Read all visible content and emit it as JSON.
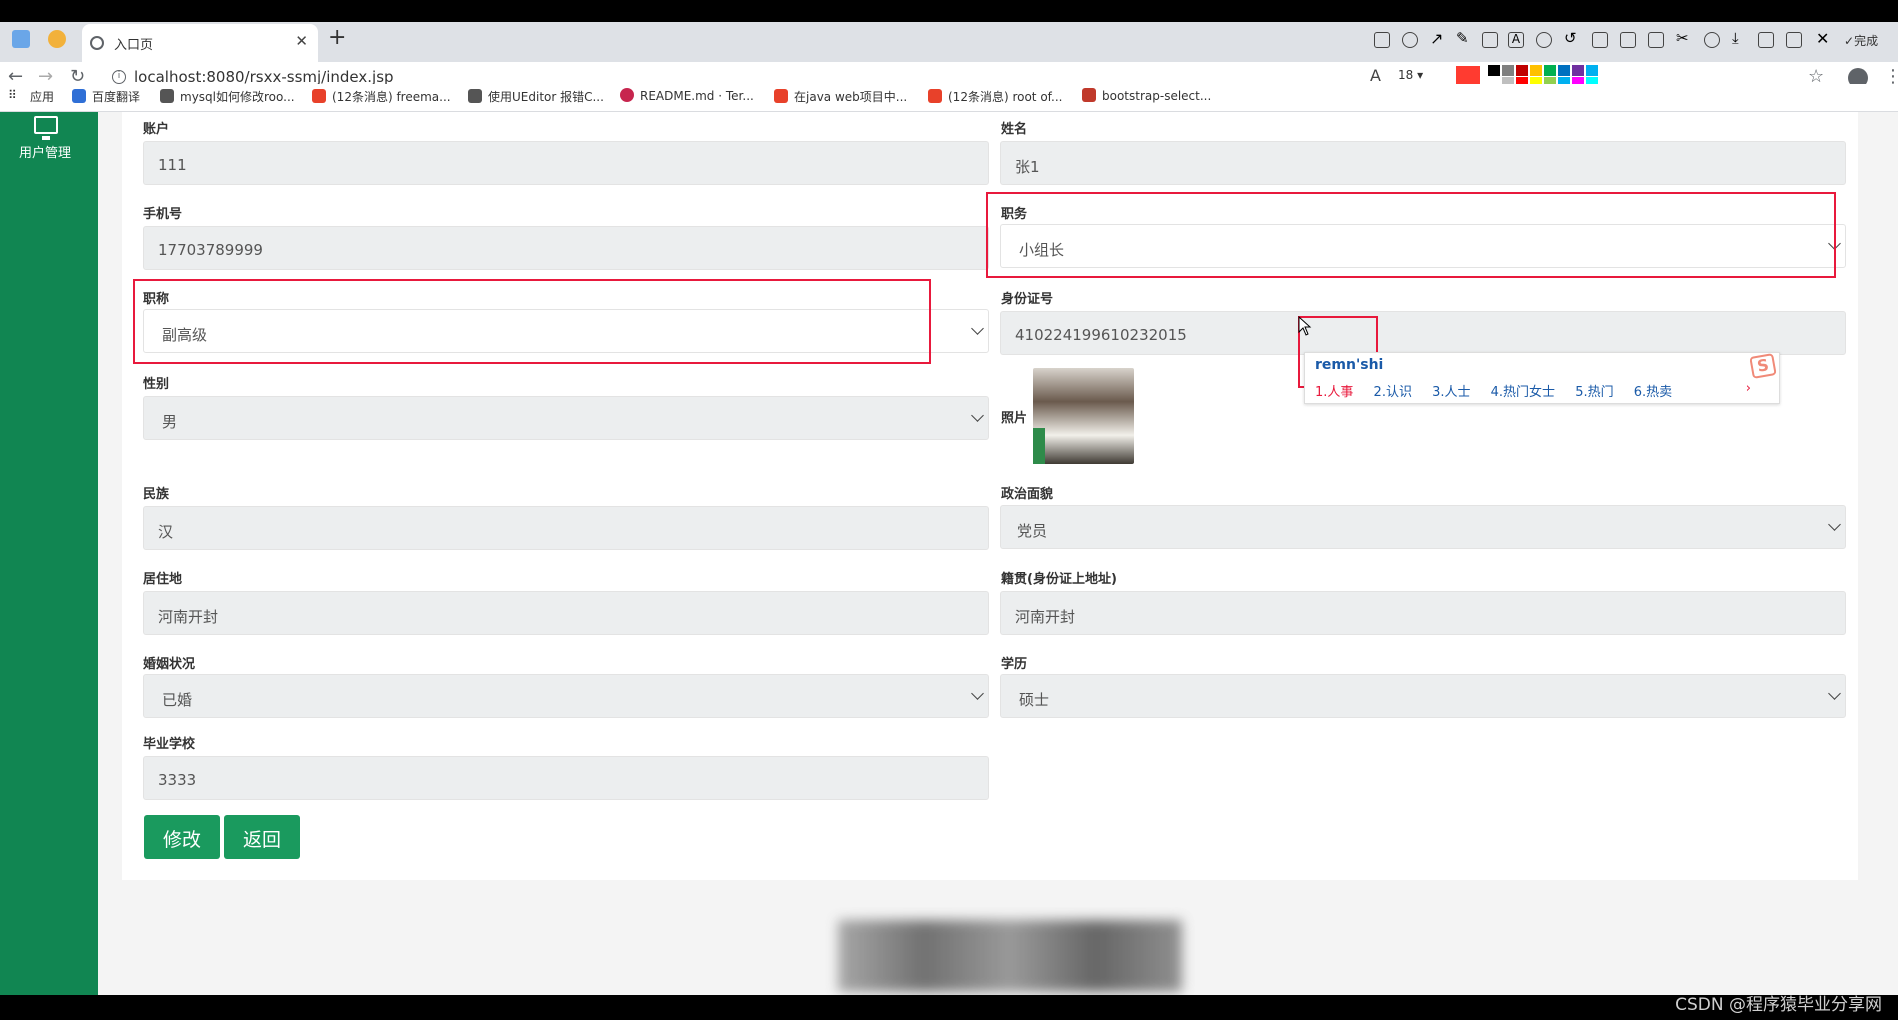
{
  "browser": {
    "tab_title": "入口页",
    "new_tab": "+",
    "url": "localhost:8080/rsxx-ssmj/index.jsp",
    "bookmarks": [
      "应用",
      "百度翻译",
      "mysql如何修改roo...",
      "(12条消息) freema...",
      "使用UEditor 报错C...",
      "README.md · Ter...",
      "在java web项目中...",
      "(12条消息) root of...",
      "bootstrap-select..."
    ],
    "toolbar_font_size": "18",
    "toolbar_done": "完成",
    "swatch_colors": [
      "#ff3b30",
      "#000000",
      "#7f7f7f",
      "#c00000",
      "#ffc000",
      "#00b050",
      "#0070c0",
      "#7030a0",
      "#00b0f0",
      "#ffffff",
      "#bfbfbf",
      "#ff0000",
      "#ffff00",
      "#92d050",
      "#00b0f0",
      "#ff00ff",
      "#00ffff"
    ]
  },
  "sidebar": {
    "item_label": "用户管理",
    "accent": "#118652"
  },
  "form": {
    "account": {
      "label": "账户",
      "value": "111"
    },
    "name": {
      "label": "姓名",
      "value": "张1"
    },
    "phone": {
      "label": "手机号",
      "value": "17703789999"
    },
    "position": {
      "label": "职务",
      "value": "小组长"
    },
    "title": {
      "label": "职称",
      "value": "副高级"
    },
    "id_number": {
      "label": "身份证号",
      "value": "410224199610232015"
    },
    "gender": {
      "label": "性别",
      "value": "男"
    },
    "photo": {
      "label": "照片"
    },
    "ethnicity": {
      "label": "民族",
      "value": "汉"
    },
    "political": {
      "label": "政治面貌",
      "value": "党员"
    },
    "residence": {
      "label": "居住地",
      "value": "河南开封"
    },
    "native_place": {
      "label": "籍贯(身份证上地址)",
      "value": "河南开封"
    },
    "marital": {
      "label": "婚姻状况",
      "value": "已婚"
    },
    "education": {
      "label": "学历",
      "value": "硕士"
    },
    "school": {
      "label": "毕业学校",
      "value": "3333"
    },
    "edit_button": "修改",
    "back_button": "返回",
    "button_color": "#1a9a5e"
  },
  "ime": {
    "input": "remn'shi",
    "candidates": [
      "1.人事",
      "2.认识",
      "3.人士",
      "4.热门女士",
      "5.热门",
      "6.热卖"
    ],
    "logo": "S",
    "next": "›"
  },
  "watermark": "CSDN @程序猿毕业分享网",
  "highlight_color": "#e8193c"
}
